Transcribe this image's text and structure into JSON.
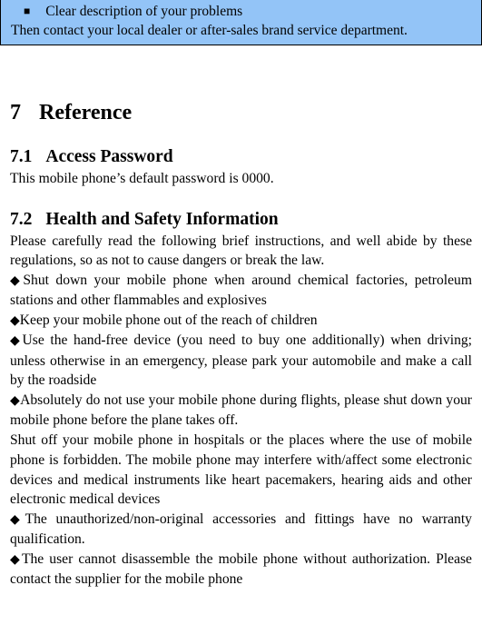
{
  "callout": {
    "bullet_icon": "black-square-bullet",
    "bullet_text": "Clear description of your problems",
    "body_text": "Then contact your local dealer or after-sales brand service department.",
    "background_color": "#93c4f7",
    "border_color": "#000000"
  },
  "chapter": {
    "number": "7",
    "title": "Reference"
  },
  "sections": [
    {
      "number": "7.1",
      "title": "Access Password",
      "paragraphs": [
        "This mobile phone’s default password is 0000."
      ]
    },
    {
      "number": "7.2",
      "title": "Health and Safety Information",
      "paragraphs": [
        "Please carefully read the following brief instructions, and well abide by these regulations, so as not to cause dangers or break the law."
      ]
    }
  ],
  "safety_items": [
    {
      "bullet": "◆",
      "text": "Shut down your mobile phone when around chemical factories, petroleum stations and other flammables and explosives"
    },
    {
      "bullet": "◆",
      "text": "Keep your mobile phone out of the reach of children"
    },
    {
      "bullet": "◆",
      "text": "Use the hand-free device (you need to buy one additionally) when driving; unless otherwise in an emergency, please park your automobile and make a call by the roadside"
    },
    {
      "bullet": "◆",
      "text": "Absolutely do not use your mobile phone during flights, please shut down your mobile phone before the plane takes off."
    },
    {
      "bullet": "",
      "text": "Shut off your mobile phone in hospitals or the places where the use of mobile phone is forbidden. The mobile phone may interfere with/affect some electronic devices and medical instruments like heart pacemakers, hearing aids and other electronic medical devices"
    },
    {
      "bullet": "◆",
      "text": "The unauthorized/non-original accessories and fittings have no warranty qualification."
    },
    {
      "bullet": "◆",
      "text": "The user cannot disassemble the mobile phone without authorization. Please contact the supplier for the mobile phone"
    }
  ]
}
